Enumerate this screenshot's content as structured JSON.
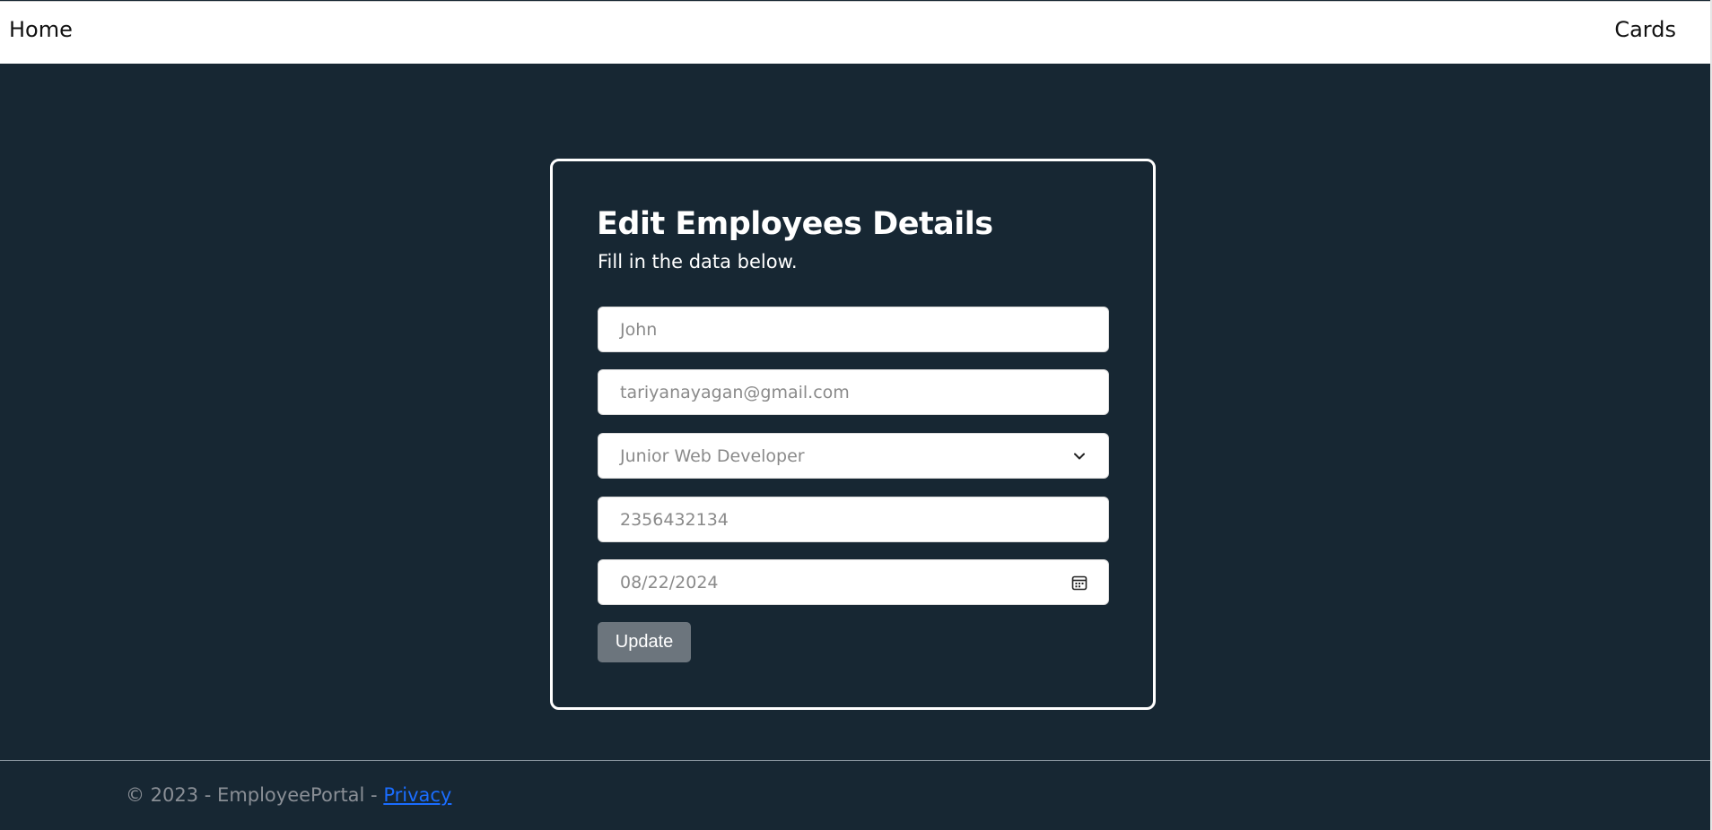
{
  "nav": {
    "home_label": "Home",
    "cards_label": "Cards"
  },
  "form": {
    "title": "Edit Employees Details",
    "subtitle": "Fill in the data below.",
    "name_value": "John",
    "email_value": "tariyanayagan@gmail.com",
    "position_value": "Junior Web Developer",
    "phone_value": "2356432134",
    "date_value": "08/22/2024",
    "submit_label": "Update"
  },
  "footer": {
    "copyright_text": "© 2023 - EmployeePortal - ",
    "privacy_label": "Privacy"
  },
  "icons": {
    "select_arrow": "chevron-down-icon",
    "date_picker": "calendar-icon"
  },
  "colors": {
    "background": "#172733",
    "card_border": "#ffffff",
    "button": "#6c757d",
    "link": "#1a6dff"
  }
}
